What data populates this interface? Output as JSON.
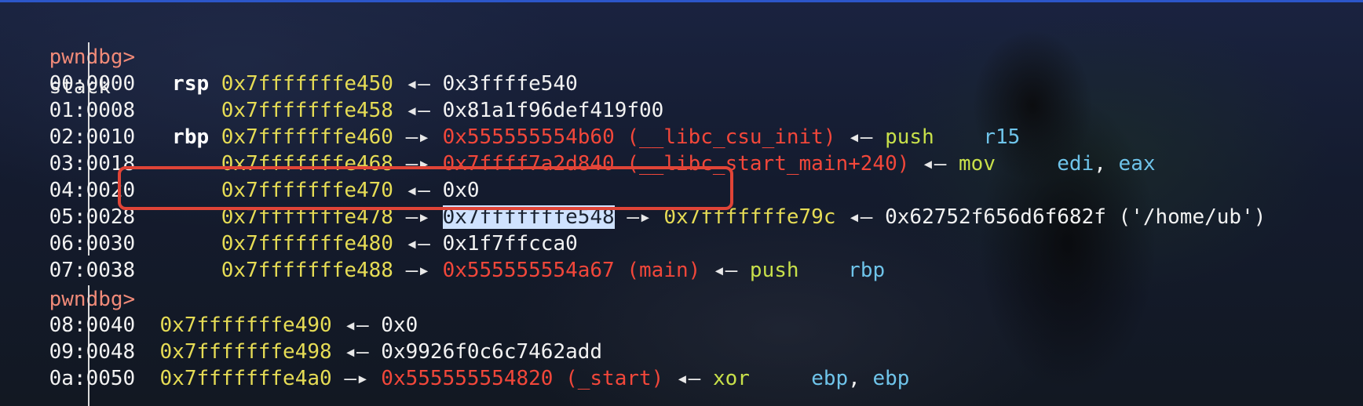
{
  "prompt": "pwndbg>",
  "command": "stack",
  "arrows": {
    "left": "◂—",
    "right": "—▸"
  },
  "rows": [
    {
      "idx": "00:0000",
      "reg": "rsp",
      "addr": "0x7fffffffe450",
      "dir": "left",
      "val": "0x3ffffe540"
    },
    {
      "idx": "01:0008",
      "reg": "",
      "addr": "0x7fffffffe458",
      "dir": "left",
      "val": "0x81a1f96def419f00"
    },
    {
      "idx": "02:0010",
      "reg": "rbp",
      "addr": "0x7fffffffe460",
      "dir": "right",
      "code": "0x555555554b60 (__libc_csu_init)",
      "ins": "push",
      "operands": [
        "r15"
      ]
    },
    {
      "idx": "03:0018",
      "reg": "",
      "addr": "0x7fffffffe468",
      "dir": "right",
      "code": "0x7ffff7a2d840 (__libc_start_main+240)",
      "ins": "mov",
      "operands": [
        "edi",
        "eax"
      ]
    },
    {
      "idx": "04:0020",
      "reg": "",
      "addr": "0x7fffffffe470",
      "dir": "left",
      "val": "0x0"
    },
    {
      "idx": "05:0028",
      "reg": "",
      "addr": "0x7fffffffe478",
      "dir": "right",
      "sel": "0x7fffffffe548",
      "addr2": "0x7fffffffe79c",
      "val": "0x62752f656d6f682f ('/home/ub')"
    },
    {
      "idx": "06:0030",
      "reg": "",
      "addr": "0x7fffffffe480",
      "dir": "left",
      "val": "0x1f7ffcca0"
    },
    {
      "idx": "07:0038",
      "reg": "",
      "addr": "0x7fffffffe488",
      "dir": "right",
      "code": "0x555555554a67 (main)",
      "ins": "push",
      "operands": [
        "rbp"
      ]
    },
    {
      "idx": "08:0040",
      "addr": "0x7fffffffe490",
      "dir": "left",
      "val": "0x0"
    },
    {
      "idx": "09:0048",
      "addr": "0x7fffffffe498",
      "dir": "left",
      "val": "0x9926f0c6c7462add"
    },
    {
      "idx": "0a:0050",
      "addr": "0x7fffffffe4a0",
      "dir": "right",
      "code": "0x555555554820 (_start)",
      "ins": "xor",
      "operands": [
        "ebp",
        "ebp"
      ]
    }
  ]
}
